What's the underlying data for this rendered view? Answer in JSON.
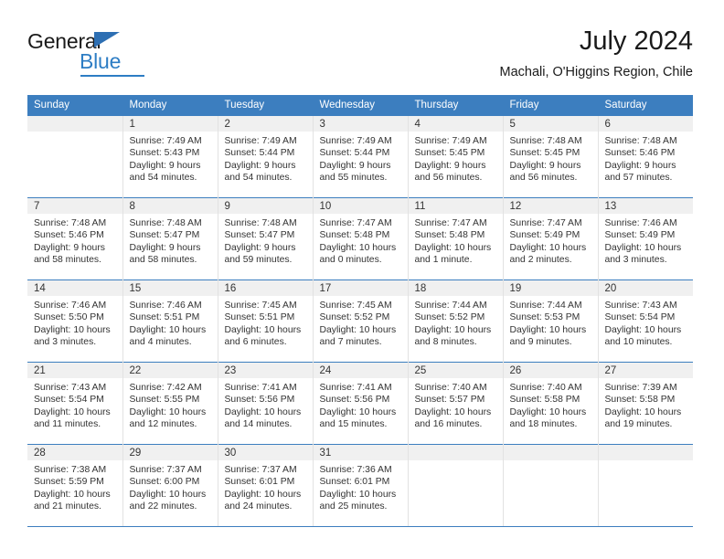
{
  "brand": {
    "name_top": "General",
    "name_bottom": "Blue",
    "accent_color": "#2d7dc4",
    "header_color": "#3c7ebf"
  },
  "header": {
    "title": "July 2024",
    "subtitle": "Machali, O'Higgins Region, Chile"
  },
  "weekday_headers": [
    "Sunday",
    "Monday",
    "Tuesday",
    "Wednesday",
    "Thursday",
    "Friday",
    "Saturday"
  ],
  "weeks": [
    [
      {
        "day": "",
        "sunrise": "",
        "sunset": "",
        "daylight_line1": "",
        "daylight_line2": ""
      },
      {
        "day": "1",
        "sunrise": "Sunrise: 7:49 AM",
        "sunset": "Sunset: 5:43 PM",
        "daylight_line1": "Daylight: 9 hours",
        "daylight_line2": "and 54 minutes."
      },
      {
        "day": "2",
        "sunrise": "Sunrise: 7:49 AM",
        "sunset": "Sunset: 5:44 PM",
        "daylight_line1": "Daylight: 9 hours",
        "daylight_line2": "and 54 minutes."
      },
      {
        "day": "3",
        "sunrise": "Sunrise: 7:49 AM",
        "sunset": "Sunset: 5:44 PM",
        "daylight_line1": "Daylight: 9 hours",
        "daylight_line2": "and 55 minutes."
      },
      {
        "day": "4",
        "sunrise": "Sunrise: 7:49 AM",
        "sunset": "Sunset: 5:45 PM",
        "daylight_line1": "Daylight: 9 hours",
        "daylight_line2": "and 56 minutes."
      },
      {
        "day": "5",
        "sunrise": "Sunrise: 7:48 AM",
        "sunset": "Sunset: 5:45 PM",
        "daylight_line1": "Daylight: 9 hours",
        "daylight_line2": "and 56 minutes."
      },
      {
        "day": "6",
        "sunrise": "Sunrise: 7:48 AM",
        "sunset": "Sunset: 5:46 PM",
        "daylight_line1": "Daylight: 9 hours",
        "daylight_line2": "and 57 minutes."
      }
    ],
    [
      {
        "day": "7",
        "sunrise": "Sunrise: 7:48 AM",
        "sunset": "Sunset: 5:46 PM",
        "daylight_line1": "Daylight: 9 hours",
        "daylight_line2": "and 58 minutes."
      },
      {
        "day": "8",
        "sunrise": "Sunrise: 7:48 AM",
        "sunset": "Sunset: 5:47 PM",
        "daylight_line1": "Daylight: 9 hours",
        "daylight_line2": "and 58 minutes."
      },
      {
        "day": "9",
        "sunrise": "Sunrise: 7:48 AM",
        "sunset": "Sunset: 5:47 PM",
        "daylight_line1": "Daylight: 9 hours",
        "daylight_line2": "and 59 minutes."
      },
      {
        "day": "10",
        "sunrise": "Sunrise: 7:47 AM",
        "sunset": "Sunset: 5:48 PM",
        "daylight_line1": "Daylight: 10 hours",
        "daylight_line2": "and 0 minutes."
      },
      {
        "day": "11",
        "sunrise": "Sunrise: 7:47 AM",
        "sunset": "Sunset: 5:48 PM",
        "daylight_line1": "Daylight: 10 hours",
        "daylight_line2": "and 1 minute."
      },
      {
        "day": "12",
        "sunrise": "Sunrise: 7:47 AM",
        "sunset": "Sunset: 5:49 PM",
        "daylight_line1": "Daylight: 10 hours",
        "daylight_line2": "and 2 minutes."
      },
      {
        "day": "13",
        "sunrise": "Sunrise: 7:46 AM",
        "sunset": "Sunset: 5:49 PM",
        "daylight_line1": "Daylight: 10 hours",
        "daylight_line2": "and 3 minutes."
      }
    ],
    [
      {
        "day": "14",
        "sunrise": "Sunrise: 7:46 AM",
        "sunset": "Sunset: 5:50 PM",
        "daylight_line1": "Daylight: 10 hours",
        "daylight_line2": "and 3 minutes."
      },
      {
        "day": "15",
        "sunrise": "Sunrise: 7:46 AM",
        "sunset": "Sunset: 5:51 PM",
        "daylight_line1": "Daylight: 10 hours",
        "daylight_line2": "and 4 minutes."
      },
      {
        "day": "16",
        "sunrise": "Sunrise: 7:45 AM",
        "sunset": "Sunset: 5:51 PM",
        "daylight_line1": "Daylight: 10 hours",
        "daylight_line2": "and 6 minutes."
      },
      {
        "day": "17",
        "sunrise": "Sunrise: 7:45 AM",
        "sunset": "Sunset: 5:52 PM",
        "daylight_line1": "Daylight: 10 hours",
        "daylight_line2": "and 7 minutes."
      },
      {
        "day": "18",
        "sunrise": "Sunrise: 7:44 AM",
        "sunset": "Sunset: 5:52 PM",
        "daylight_line1": "Daylight: 10 hours",
        "daylight_line2": "and 8 minutes."
      },
      {
        "day": "19",
        "sunrise": "Sunrise: 7:44 AM",
        "sunset": "Sunset: 5:53 PM",
        "daylight_line1": "Daylight: 10 hours",
        "daylight_line2": "and 9 minutes."
      },
      {
        "day": "20",
        "sunrise": "Sunrise: 7:43 AM",
        "sunset": "Sunset: 5:54 PM",
        "daylight_line1": "Daylight: 10 hours",
        "daylight_line2": "and 10 minutes."
      }
    ],
    [
      {
        "day": "21",
        "sunrise": "Sunrise: 7:43 AM",
        "sunset": "Sunset: 5:54 PM",
        "daylight_line1": "Daylight: 10 hours",
        "daylight_line2": "and 11 minutes."
      },
      {
        "day": "22",
        "sunrise": "Sunrise: 7:42 AM",
        "sunset": "Sunset: 5:55 PM",
        "daylight_line1": "Daylight: 10 hours",
        "daylight_line2": "and 12 minutes."
      },
      {
        "day": "23",
        "sunrise": "Sunrise: 7:41 AM",
        "sunset": "Sunset: 5:56 PM",
        "daylight_line1": "Daylight: 10 hours",
        "daylight_line2": "and 14 minutes."
      },
      {
        "day": "24",
        "sunrise": "Sunrise: 7:41 AM",
        "sunset": "Sunset: 5:56 PM",
        "daylight_line1": "Daylight: 10 hours",
        "daylight_line2": "and 15 minutes."
      },
      {
        "day": "25",
        "sunrise": "Sunrise: 7:40 AM",
        "sunset": "Sunset: 5:57 PM",
        "daylight_line1": "Daylight: 10 hours",
        "daylight_line2": "and 16 minutes."
      },
      {
        "day": "26",
        "sunrise": "Sunrise: 7:40 AM",
        "sunset": "Sunset: 5:58 PM",
        "daylight_line1": "Daylight: 10 hours",
        "daylight_line2": "and 18 minutes."
      },
      {
        "day": "27",
        "sunrise": "Sunrise: 7:39 AM",
        "sunset": "Sunset: 5:58 PM",
        "daylight_line1": "Daylight: 10 hours",
        "daylight_line2": "and 19 minutes."
      }
    ],
    [
      {
        "day": "28",
        "sunrise": "Sunrise: 7:38 AM",
        "sunset": "Sunset: 5:59 PM",
        "daylight_line1": "Daylight: 10 hours",
        "daylight_line2": "and 21 minutes."
      },
      {
        "day": "29",
        "sunrise": "Sunrise: 7:37 AM",
        "sunset": "Sunset: 6:00 PM",
        "daylight_line1": "Daylight: 10 hours",
        "daylight_line2": "and 22 minutes."
      },
      {
        "day": "30",
        "sunrise": "Sunrise: 7:37 AM",
        "sunset": "Sunset: 6:01 PM",
        "daylight_line1": "Daylight: 10 hours",
        "daylight_line2": "and 24 minutes."
      },
      {
        "day": "31",
        "sunrise": "Sunrise: 7:36 AM",
        "sunset": "Sunset: 6:01 PM",
        "daylight_line1": "Daylight: 10 hours",
        "daylight_line2": "and 25 minutes."
      },
      {
        "day": "",
        "sunrise": "",
        "sunset": "",
        "daylight_line1": "",
        "daylight_line2": ""
      },
      {
        "day": "",
        "sunrise": "",
        "sunset": "",
        "daylight_line1": "",
        "daylight_line2": ""
      },
      {
        "day": "",
        "sunrise": "",
        "sunset": "",
        "daylight_line1": "",
        "daylight_line2": ""
      }
    ]
  ]
}
